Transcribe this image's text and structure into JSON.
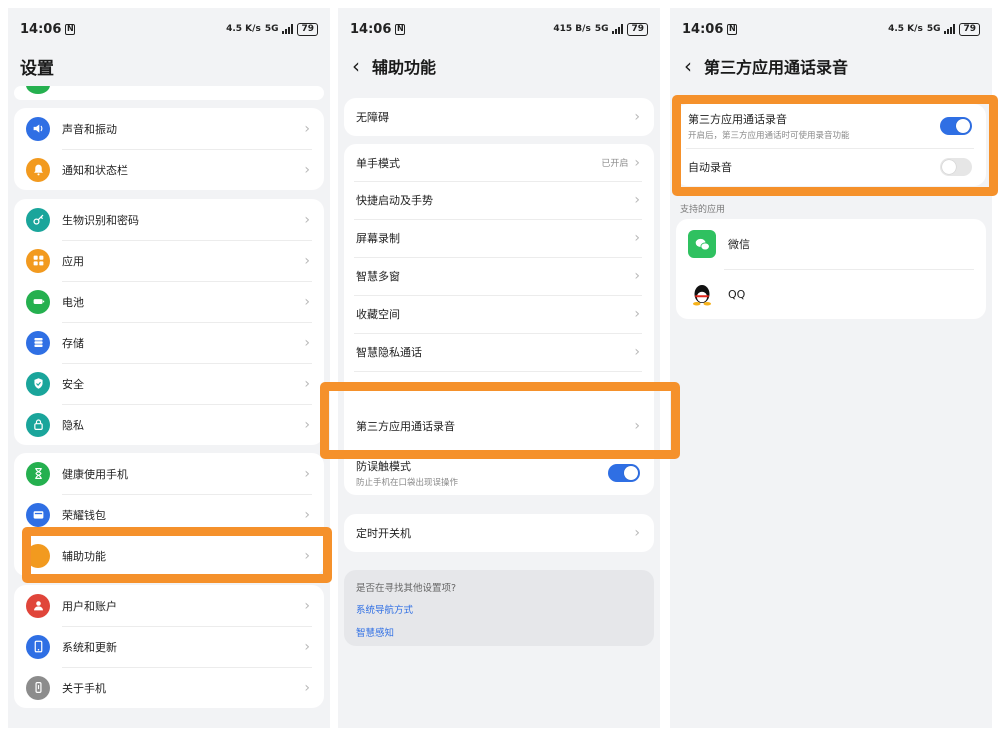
{
  "status": {
    "time": "14:06",
    "nfc": "N",
    "net_speed_1": "4.5 K/s",
    "net_speed_2": "415 B/s",
    "net_speed_3": "4.5 K/s",
    "net": "5G",
    "battery": "79"
  },
  "screen1": {
    "title": "设置",
    "groups": [
      [
        {
          "label": "声音和振动",
          "icon": "volume-icon",
          "color": "#2f6fe4"
        },
        {
          "label": "通知和状态栏",
          "icon": "bell-icon",
          "color": "#f29a1f"
        }
      ],
      [
        {
          "label": "生物识别和密码",
          "icon": "key-icon",
          "color": "#1aa59b"
        },
        {
          "label": "应用",
          "icon": "grid-icon",
          "color": "#f29a1f"
        },
        {
          "label": "电池",
          "icon": "battery-icon",
          "color": "#25b04f"
        },
        {
          "label": "存储",
          "icon": "storage-icon",
          "color": "#2f6fe4"
        },
        {
          "label": "安全",
          "icon": "shield-icon",
          "color": "#1aa59b"
        },
        {
          "label": "隐私",
          "icon": "lock-icon",
          "color": "#1aa59b"
        }
      ],
      [
        {
          "label": "健康使用手机",
          "icon": "hourglass-icon",
          "color": "#25b04f"
        },
        {
          "label": "荣耀钱包",
          "icon": "wallet-icon",
          "color": "#2f6fe4"
        },
        {
          "label": "辅助功能",
          "icon": "hand-icon",
          "color": "#f29a1f"
        }
      ],
      [
        {
          "label": "用户和账户",
          "icon": "user-icon",
          "color": "#e0453a"
        },
        {
          "label": "系统和更新",
          "icon": "phone-icon",
          "color": "#2f6fe4"
        },
        {
          "label": "关于手机",
          "icon": "info-icon",
          "color": "#8c8c8c"
        }
      ]
    ]
  },
  "screen2": {
    "title": "辅助功能",
    "accessibility": "无障碍",
    "one_hand": "单手模式",
    "one_hand_value": "已开启",
    "items": [
      "快捷启动及手势",
      "屏幕录制",
      "智慧多窗",
      "收藏空间",
      "智慧隐私通话"
    ],
    "third_party": "第三方应用通话录音",
    "mistouch": "防误触模式",
    "mistouch_sub": "防止手机在口袋出现误操作",
    "mistouch_on": true,
    "timer": "定时开关机",
    "suggest_title": "是否在寻找其他设置项?",
    "suggest_links": [
      "系统导航方式",
      "智慧感知"
    ]
  },
  "screen3": {
    "title": "第三方应用通话录音",
    "main_toggle_label": "第三方应用通话录音",
    "main_toggle_sub": "开启后，第三方应用通话时可使用录音功能",
    "main_toggle_on": true,
    "auto_label": "自动录音",
    "auto_on": false,
    "supported_label": "支持的应用",
    "apps": [
      {
        "name": "微信",
        "icon": "wechat-icon"
      },
      {
        "name": "QQ",
        "icon": "qq-icon"
      }
    ]
  },
  "highlight_color": "#f5912b"
}
